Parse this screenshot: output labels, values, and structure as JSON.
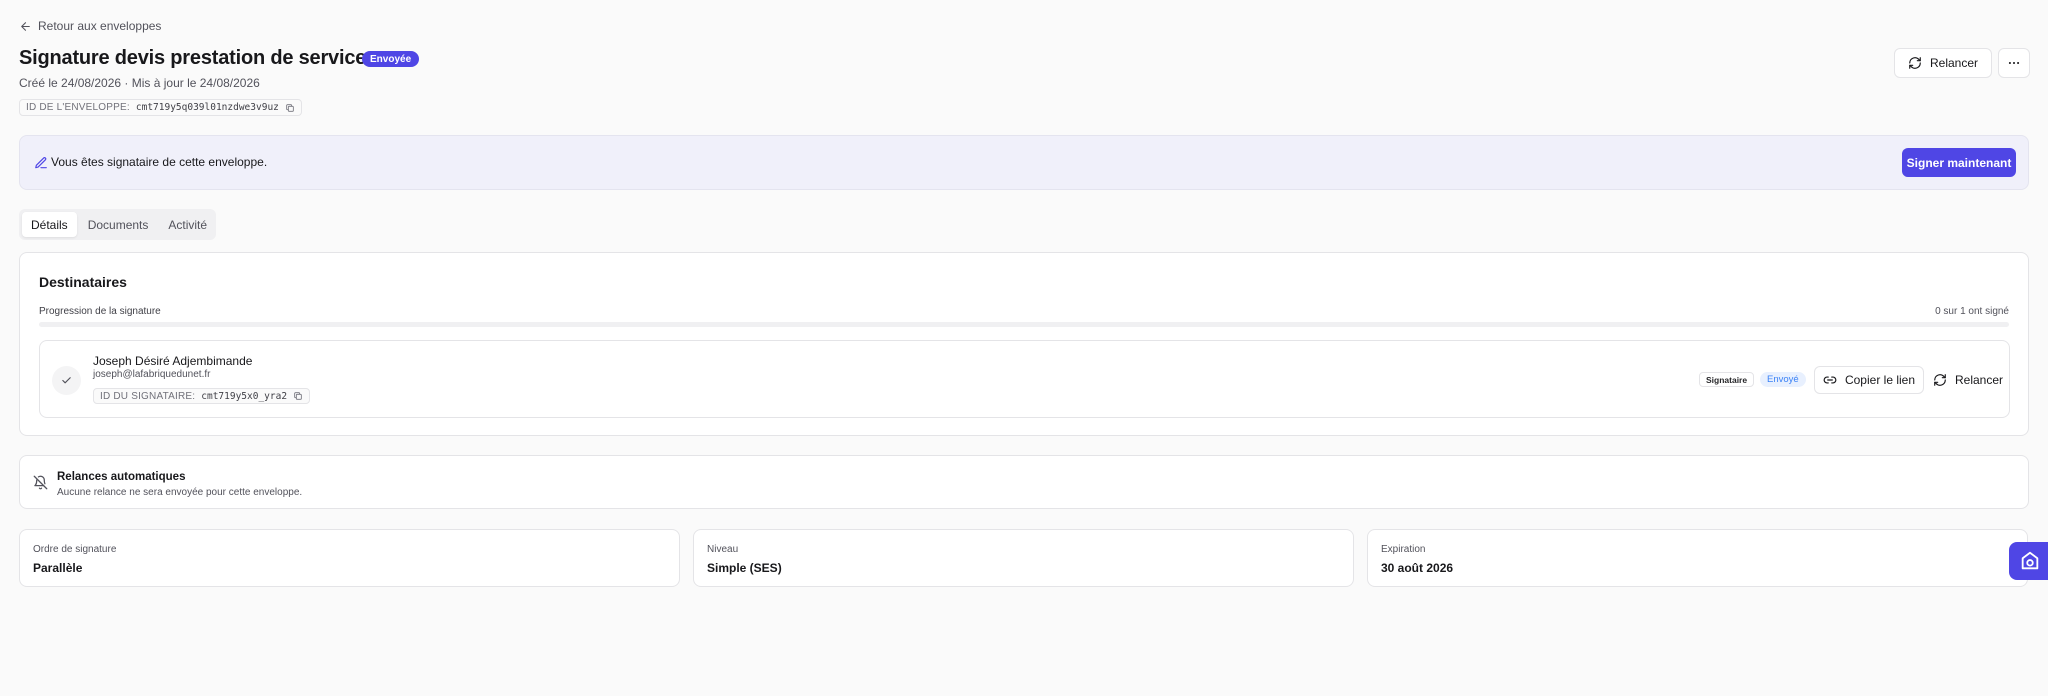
{
  "header": {
    "back_label": "Retour aux enveloppes",
    "title": "Signature devis prestation de services",
    "status": "Envoyée",
    "dates": "Créé le 24/08/2026 · Mis à jour le 24/08/2026",
    "envelope_id_label": "ID DE L'ENVELOPPE:",
    "envelope_id": "cmt719y5q039l01nzdwe3v9uz",
    "relancer_label": "Relancer"
  },
  "banner": {
    "text": "Vous êtes signataire de cette enveloppe.",
    "sign_label": "Signer maintenant"
  },
  "tabs": [
    {
      "label": "Détails",
      "active": true
    },
    {
      "label": "Documents",
      "active": false
    },
    {
      "label": "Activité",
      "active": false
    }
  ],
  "recipients": {
    "title": "Destinataires",
    "progress_label": "Progression de la signature",
    "progress_count": "0 sur 1 ont signé",
    "progress_fraction": 0,
    "signer": {
      "name": "Joseph Désiré Adjembimande",
      "email": "joseph@lafabriquedunet.fr",
      "id_label": "ID DU SIGNATAIRE:",
      "id": "cmt719y5x0_yra2",
      "role": "Signataire",
      "status": "Envoyé",
      "copy_link_label": "Copier le lien",
      "relancer_label": "Relancer"
    }
  },
  "reminders": {
    "title": "Relances automatiques",
    "description": "Aucune relance ne sera envoyée pour cette enveloppe."
  },
  "info": [
    {
      "label": "Ordre de signature",
      "value": "Parallèle"
    },
    {
      "label": "Niveau",
      "value": "Simple (SES)"
    },
    {
      "label": "Expiration",
      "value": "30 août 2026"
    }
  ],
  "colors": {
    "accent": "#4f46e5",
    "banner_bg": "#f0f0fa",
    "sent_badge": "#3b82f6"
  }
}
